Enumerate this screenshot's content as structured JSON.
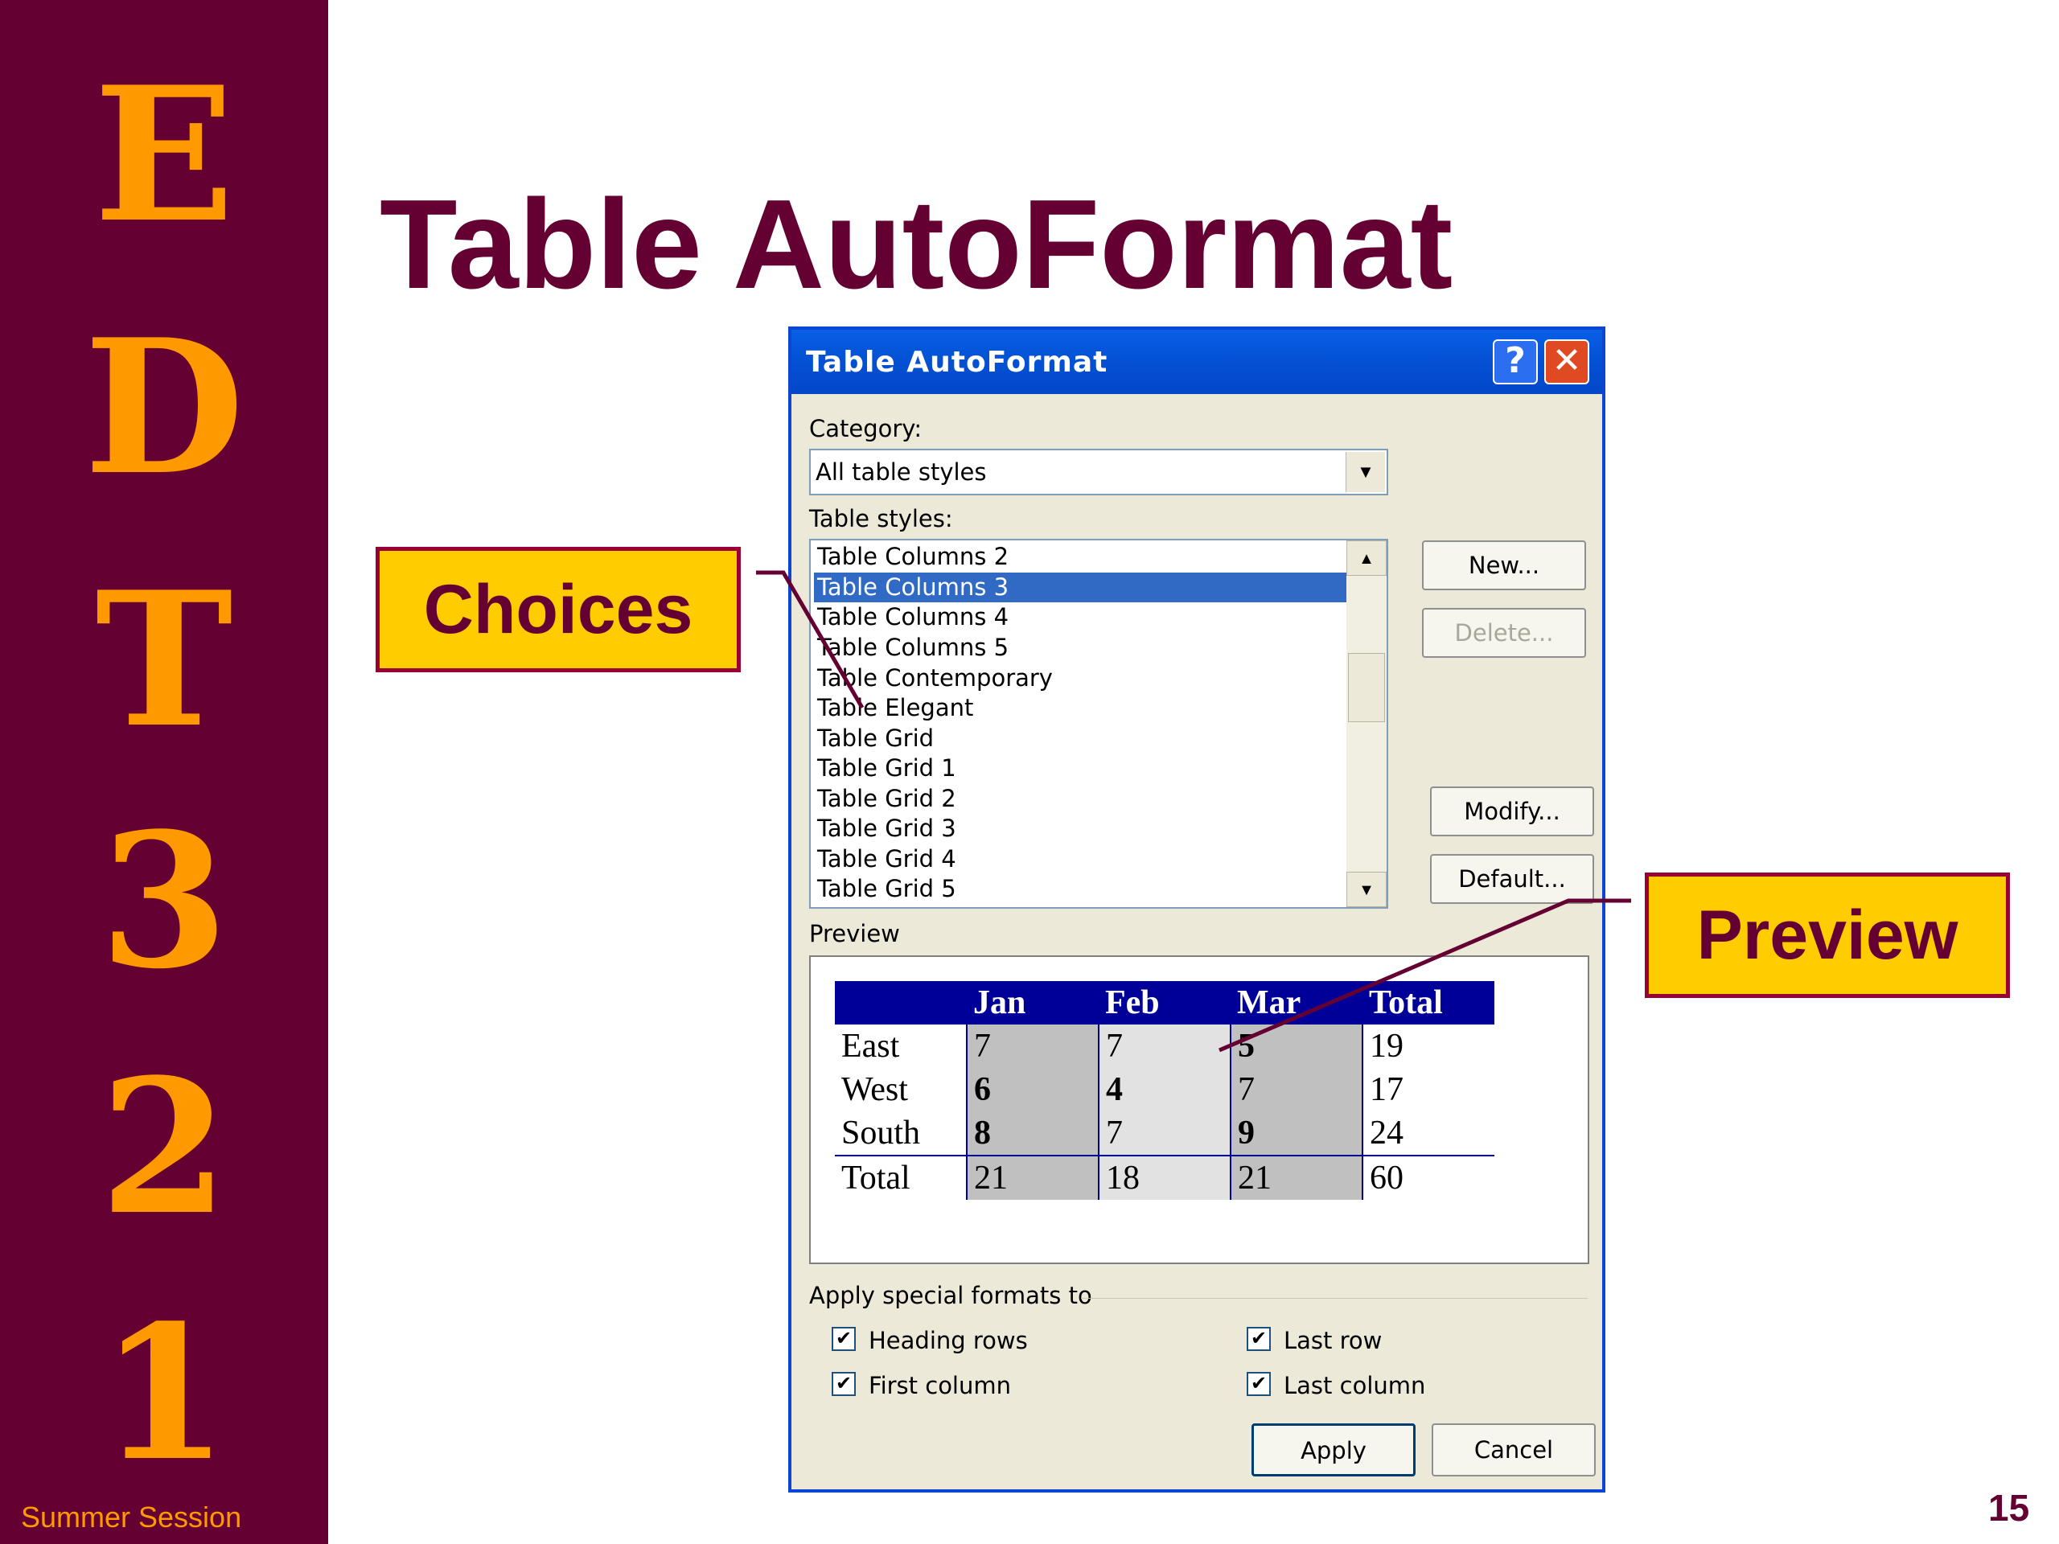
{
  "sidebar": {
    "letters": [
      "E",
      "D",
      "T",
      "3",
      "2",
      "1"
    ],
    "footer": "Summer Session"
  },
  "slide": {
    "title": "Table AutoFormat",
    "page_number": "15"
  },
  "callouts": {
    "choices": "Choices",
    "preview": "Preview"
  },
  "dialog": {
    "title": "Table AutoFormat",
    "help_label": "?",
    "close_label": "✕",
    "category_label": "Category:",
    "category_value": "All table styles",
    "styles_label": "Table styles:",
    "styles": [
      "Table Columns 2",
      "Table Columns 3",
      "Table Columns 4",
      "Table Columns 5",
      "Table Contemporary",
      "Table Elegant",
      "Table Grid",
      "Table Grid 1",
      "Table Grid 2",
      "Table Grid 3",
      "Table Grid 4",
      "Table Grid 5"
    ],
    "selected_style": "Table Columns 3",
    "buttons": {
      "new": "New...",
      "delete": "Delete...",
      "modify": "Modify...",
      "default": "Default...",
      "apply": "Apply",
      "cancel": "Cancel"
    },
    "preview_label": "Preview",
    "preview_table": {
      "header": [
        "",
        "Jan",
        "Feb",
        "Mar",
        "Total"
      ],
      "rows": [
        [
          "East",
          "7",
          "7",
          "5",
          "19"
        ],
        [
          "West",
          "6",
          "4",
          "7",
          "17"
        ],
        [
          "South",
          "8",
          "7",
          "9",
          "24"
        ],
        [
          "Total",
          "21",
          "18",
          "21",
          "60"
        ]
      ]
    },
    "special_formats_label": "Apply special formats to",
    "checkboxes": {
      "heading_rows": {
        "label": "Heading rows",
        "checked": true
      },
      "first_column": {
        "label": "First column",
        "checked": true
      },
      "last_row": {
        "label": "Last row",
        "checked": true
      },
      "last_column": {
        "label": "Last column",
        "checked": true
      }
    },
    "check_glyph": "✔"
  }
}
